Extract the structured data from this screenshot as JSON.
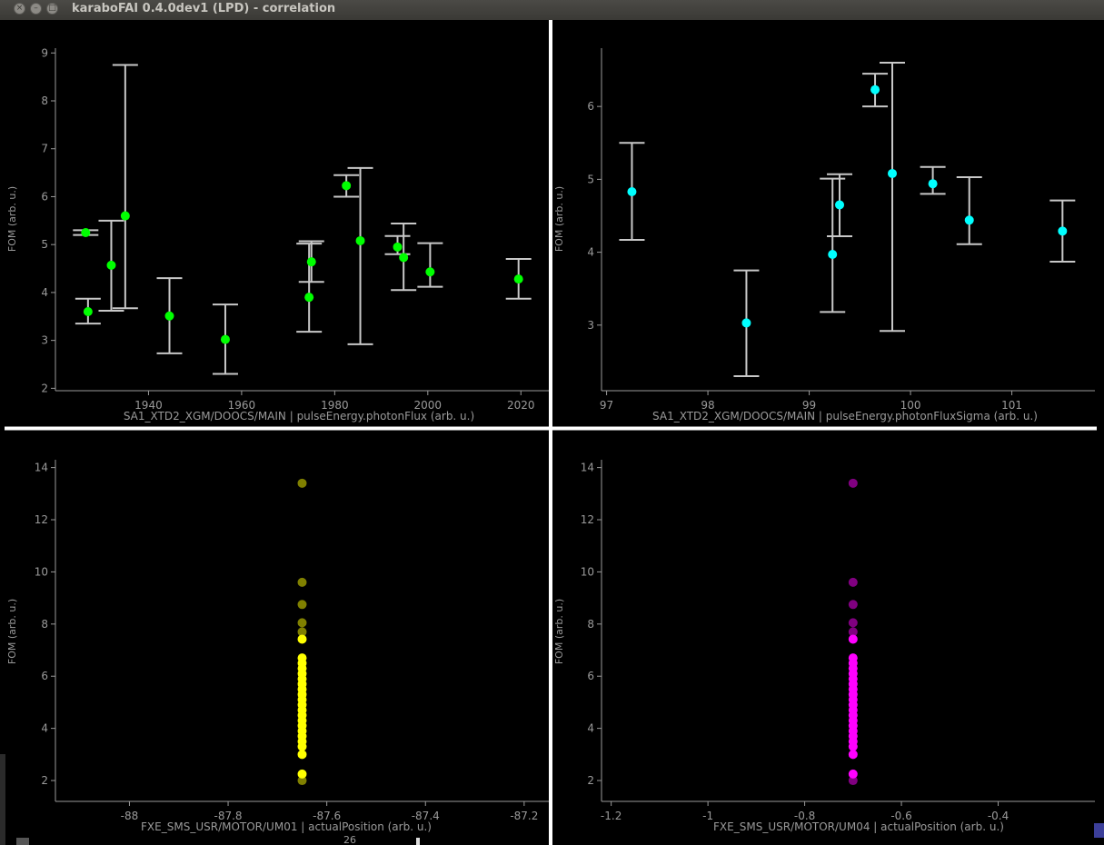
{
  "window": {
    "title": "karaboFAI 0.4.0dev1 (LPD) - correlation",
    "buttons": [
      "close",
      "minimize",
      "maximize"
    ]
  },
  "colors": {
    "background": "#000000",
    "axis": "#9a9a9a",
    "error_bar": "#c8c8c8",
    "separator": "#ffffff",
    "plot1": "#00ff00",
    "plot2": "#00ffff",
    "plot3": "#ffff00",
    "plot4": "#ff00ff"
  },
  "chart_data": [
    {
      "type": "scatter",
      "xlabel": "SA1_XTD2_XGM/DOOCS/MAIN | pulseEnergy.photonFlux (arb. u.)",
      "ylabel": "FOM (arb. u.)",
      "xlim": [
        1920,
        2026
      ],
      "ylim": [
        1.95,
        9.1
      ],
      "xticks": [
        1940,
        1960,
        1980,
        2000,
        2020
      ],
      "yticks": [
        2,
        3,
        4,
        5,
        6,
        7,
        8,
        9
      ],
      "marker_color": "#00ff00",
      "points": [
        {
          "x": 1926.5,
          "y": 5.25,
          "lo": 5.2,
          "hi": 5.3
        },
        {
          "x": 1927.0,
          "y": 3.6,
          "lo": 3.35,
          "hi": 3.87
        },
        {
          "x": 1932.0,
          "y": 4.57,
          "lo": 3.62,
          "hi": 5.5
        },
        {
          "x": 1935.0,
          "y": 5.6,
          "lo": 3.67,
          "hi": 8.75
        },
        {
          "x": 1944.5,
          "y": 3.51,
          "lo": 2.73,
          "hi": 4.3
        },
        {
          "x": 1956.5,
          "y": 3.02,
          "lo": 2.3,
          "hi": 3.75
        },
        {
          "x": 1974.5,
          "y": 3.9,
          "lo": 3.18,
          "hi": 5.02
        },
        {
          "x": 1975.0,
          "y": 4.64,
          "lo": 4.22,
          "hi": 5.07
        },
        {
          "x": 1982.5,
          "y": 6.23,
          "lo": 6.0,
          "hi": 6.45
        },
        {
          "x": 1985.5,
          "y": 5.08,
          "lo": 2.92,
          "hi": 6.6
        },
        {
          "x": 1993.5,
          "y": 4.95,
          "lo": 4.8,
          "hi": 5.18
        },
        {
          "x": 1994.8,
          "y": 4.73,
          "lo": 4.05,
          "hi": 5.44
        },
        {
          "x": 2000.5,
          "y": 4.43,
          "lo": 4.12,
          "hi": 5.03
        },
        {
          "x": 2019.5,
          "y": 4.28,
          "lo": 3.87,
          "hi": 4.7
        }
      ]
    },
    {
      "type": "scatter",
      "xlabel": "SA1_XTD2_XGM/DOOCS/MAIN | pulseEnergy.photonFluxSigma (arb. u.)",
      "ylabel": "FOM (arb. u.)",
      "xlim": [
        96.95,
        101.82
      ],
      "ylim": [
        2.1,
        6.8
      ],
      "xticks": [
        97,
        98,
        99,
        100,
        101
      ],
      "yticks": [
        3,
        4,
        5,
        6
      ],
      "marker_color": "#00ffff",
      "points": [
        {
          "x": 97.25,
          "y": 4.83,
          "lo": 4.17,
          "hi": 5.5
        },
        {
          "x": 98.38,
          "y": 3.03,
          "lo": 2.3,
          "hi": 3.75
        },
        {
          "x": 99.23,
          "y": 3.97,
          "lo": 3.18,
          "hi": 5.01
        },
        {
          "x": 99.3,
          "y": 4.65,
          "lo": 4.22,
          "hi": 5.07
        },
        {
          "x": 99.65,
          "y": 6.23,
          "lo": 6.0,
          "hi": 6.45
        },
        {
          "x": 99.82,
          "y": 5.08,
          "lo": 2.92,
          "hi": 6.6
        },
        {
          "x": 100.22,
          "y": 4.94,
          "lo": 4.8,
          "hi": 5.17
        },
        {
          "x": 100.58,
          "y": 4.44,
          "lo": 4.11,
          "hi": 5.03
        },
        {
          "x": 101.5,
          "y": 4.29,
          "lo": 3.87,
          "hi": 4.71
        }
      ]
    },
    {
      "type": "scatter",
      "xlabel": "FXE_SMS_USR/MOTOR/UM01 | actualPosition (arb. u.)",
      "ylabel": "FOM (arb. u.)",
      "xlim": [
        -88.15,
        -87.15
      ],
      "ylim": [
        1.2,
        14.3
      ],
      "xticks": [
        -88,
        -87.8,
        -87.6,
        -87.4,
        -87.2
      ],
      "yticks": [
        2,
        4,
        6,
        8,
        10,
        12,
        14
      ],
      "marker_color": "#ffff00",
      "x_value": -87.65,
      "y_values_faded": [
        13.4,
        9.6,
        8.75,
        8.05,
        7.7,
        2.0
      ],
      "y_values": [
        7.42,
        6.7,
        6.5,
        6.3,
        6.1,
        5.9,
        5.7,
        5.5,
        5.3,
        5.1,
        4.9,
        4.7,
        4.5,
        4.3,
        4.1,
        3.9,
        3.7,
        3.5,
        3.3,
        3.0,
        2.25
      ]
    },
    {
      "type": "scatter",
      "xlabel": "FXE_SMS_USR/MOTOR/UM04 | actualPosition (arb. u.)",
      "ylabel": "FOM (arb. u.)",
      "xlim": [
        -1.22,
        -0.2
      ],
      "ylim": [
        1.2,
        14.3
      ],
      "xticks": [
        -1.2,
        -1,
        -0.8,
        -0.6,
        -0.4
      ],
      "yticks": [
        2,
        4,
        6,
        8,
        10,
        12,
        14
      ],
      "marker_color": "#ff00ff",
      "x_value": -0.7,
      "y_values_faded": [
        13.4,
        9.6,
        8.75,
        8.05,
        7.7,
        2.0
      ],
      "y_values": [
        7.42,
        6.7,
        6.5,
        6.3,
        6.1,
        5.9,
        5.7,
        5.5,
        5.3,
        5.1,
        4.9,
        4.7,
        4.5,
        4.3,
        4.1,
        3.9,
        3.7,
        3.5,
        3.3,
        3.0,
        2.25
      ]
    }
  ],
  "taskbar": {
    "partial_label": "26"
  }
}
